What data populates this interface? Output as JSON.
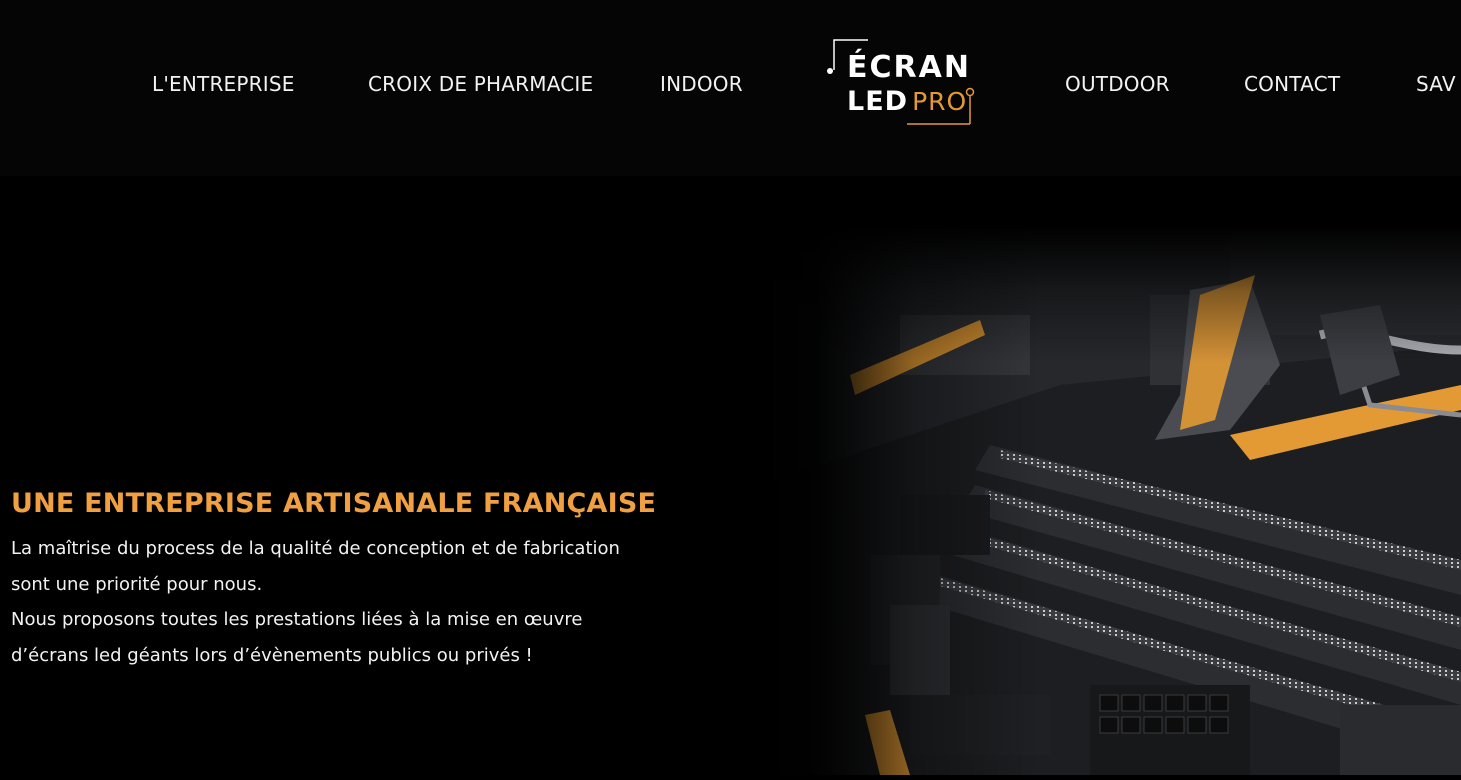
{
  "nav": {
    "items": [
      {
        "label": "L'ENTREPRISE"
      },
      {
        "label": "CROIX DE PHARMACIE"
      },
      {
        "label": "INDOOR"
      },
      {
        "label": "OUTDOOR"
      },
      {
        "label": "CONTACT"
      },
      {
        "label": "SAV"
      }
    ]
  },
  "logo": {
    "line1": "ÉCRAN",
    "word_led": "LED",
    "word_pro": "PRO"
  },
  "hero": {
    "title": "UNE ENTREPRISE ARTISANALE FRANÇAISE",
    "paragraph1": "La maîtrise du process de la qualité de conception et de fabrication sont une priorité pour nous.",
    "paragraph2": "Nous proposons toutes les prestations liées à la mise en œuvre d’écrans led géants lors d’évènements publics ou privés !",
    "image_icon": "motherboard-photo"
  },
  "colors": {
    "accent": "#e39a34",
    "background": "#000000",
    "header_background": "#050505",
    "text": "#f2f2f2"
  }
}
